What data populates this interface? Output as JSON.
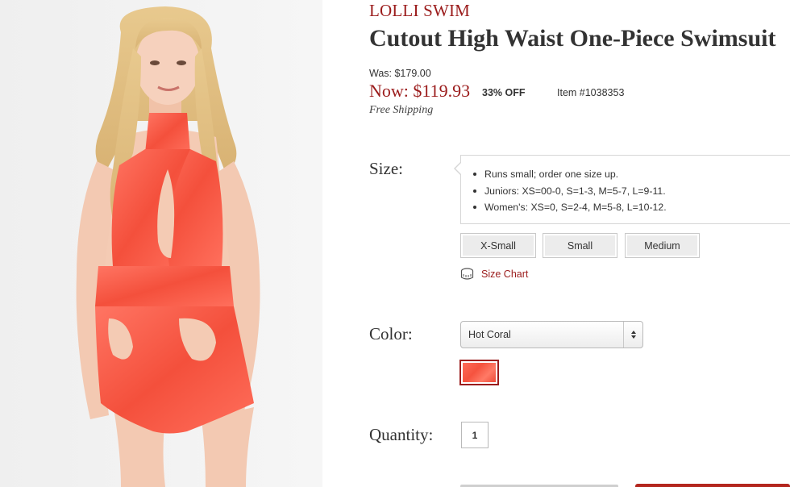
{
  "product": {
    "brand": "LOLLI SWIM",
    "title": "Cutout High Waist One-Piece Swimsuit",
    "was_price": "Was: $179.00",
    "now_price": "Now: $119.93",
    "discount": "33% OFF",
    "item_number": "Item #1038353",
    "shipping": "Free Shipping",
    "photo_icon": "swimsuit-model-photo"
  },
  "size": {
    "label": "Size:",
    "notes": [
      "Runs small; order one size up.",
      "Juniors: XS=00-0, S=1-3, M=5-7, L=9-11.",
      "Women's: XS=0, S=2-4, M=5-8, L=10-12."
    ],
    "options": [
      "X-Small",
      "Small",
      "Medium"
    ],
    "size_chart_link": "Size Chart",
    "size_chart_icon": "measuring-tape-icon"
  },
  "color": {
    "label": "Color:",
    "selected": "Hot Coral",
    "swatch_color": "#f5533f",
    "select_icon": "select-arrows-icon"
  },
  "quantity": {
    "label": "Quantity:",
    "value": "1"
  },
  "colors": {
    "accent": "#9b1c1c",
    "text": "#333333",
    "button_bg": "#ececec"
  }
}
